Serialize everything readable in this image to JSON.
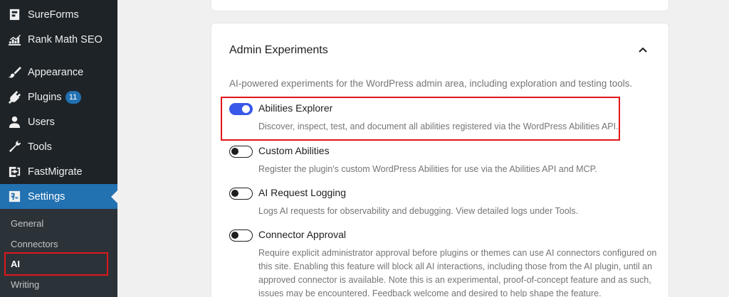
{
  "sidebar": {
    "items": [
      {
        "label": "SureForms",
        "icon": "sureforms-icon"
      },
      {
        "label": "Rank Math SEO",
        "icon": "rank-math-icon"
      },
      {
        "label": "Appearance",
        "icon": "paintbrush-icon"
      },
      {
        "label": "Plugins",
        "icon": "plugin-icon",
        "badge": "11"
      },
      {
        "label": "Users",
        "icon": "user-icon"
      },
      {
        "label": "Tools",
        "icon": "wrench-icon"
      },
      {
        "label": "FastMigrate",
        "icon": "migrate-icon"
      },
      {
        "label": "Settings",
        "icon": "settings-icon",
        "active": true
      }
    ],
    "submenu": [
      "General",
      "Connectors",
      "AI",
      "Writing"
    ],
    "current_sub": "AI"
  },
  "section": {
    "title": "Admin Experiments",
    "description": "AI-powered experiments for the WordPress admin area, including exploration and testing tools.",
    "experiments": [
      {
        "label": "Abilities Explorer",
        "help": "Discover, inspect, test, and document all abilities registered via the WordPress Abilities API.",
        "enabled": true
      },
      {
        "label": "Custom Abilities",
        "help": "Register the plugin's custom WordPress Abilities for use via the Abilities API and MCP.",
        "enabled": false
      },
      {
        "label": "AI Request Logging",
        "help": "Logs AI requests for observability and debugging. View detailed logs under Tools.",
        "enabled": false
      },
      {
        "label": "Connector Approval",
        "help": "Require explicit administrator approval before plugins or themes can use AI connectors configured on this site. Enabling this feature will block all AI interactions, including those from the AI plugin, until an approved connector is available. Note this is an experimental, proof-of-concept feature and as such, issues may be encountered. Feedback welcome and desired to help shape the feature.",
        "enabled": false
      }
    ]
  },
  "colors": {
    "accent": "#3858e9",
    "highlight": "#e0161a",
    "sidebar": "#1d2327",
    "wp_blue": "#2271b1"
  }
}
